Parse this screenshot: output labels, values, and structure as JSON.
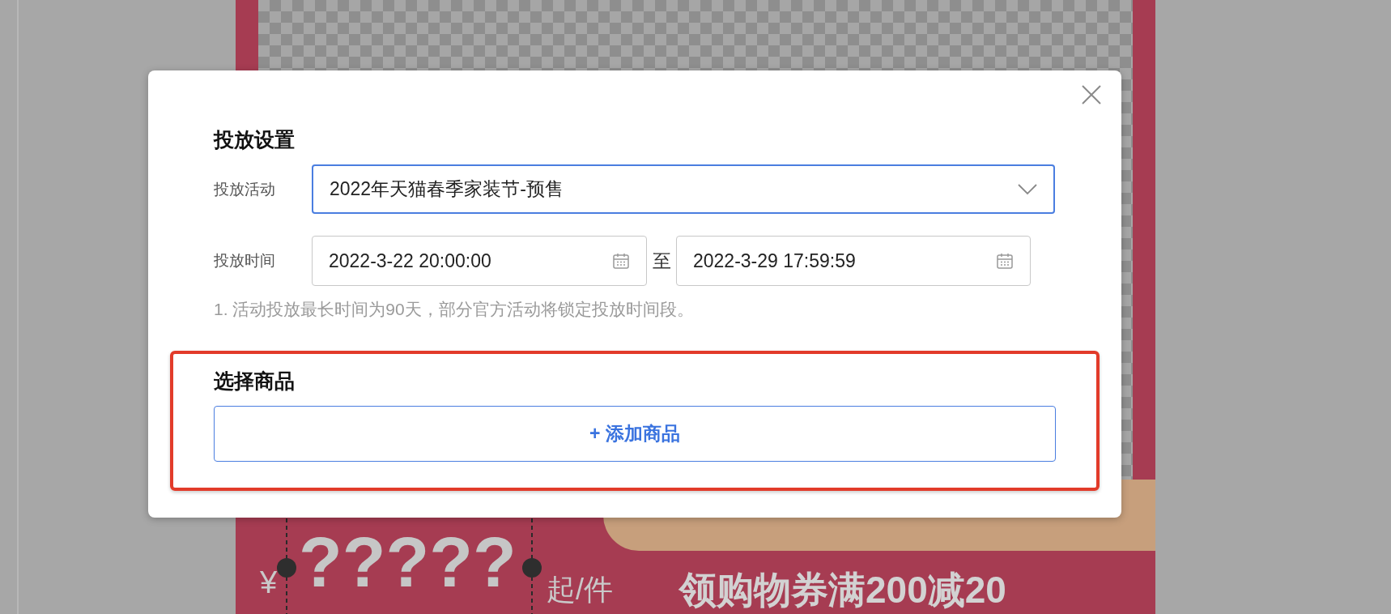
{
  "poster": {
    "currency": "¥",
    "price": "?????",
    "unit": "起/件",
    "coupon": "领购物券满200减20"
  },
  "dialog": {
    "settings": {
      "title": "投放设置",
      "activity": {
        "label": "投放活动",
        "value": "2022年天猫春季家装节-预售",
        "focused": true
      },
      "time": {
        "label": "投放时间",
        "start": "2022-3-22 20:00:00",
        "separator": "至",
        "end": "2022-3-29 17:59:59"
      },
      "note": "1. 活动投放最长时间为90天，部分官方活动将锁定投放时间段。"
    },
    "products": {
      "title": "选择商品",
      "highlighted": true,
      "add_button": "+ 添加商品"
    }
  }
}
